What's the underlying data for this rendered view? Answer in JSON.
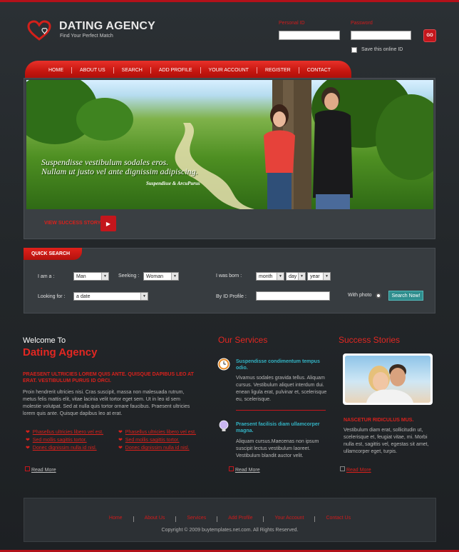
{
  "brand": {
    "title": "DATING AGENCY",
    "tagline": "Find Your Perfect Match"
  },
  "login": {
    "personal_id_label": "Personal ID",
    "password_label": "Password",
    "go_label": "GO",
    "save_label": "Save this online ID"
  },
  "nav": {
    "items": [
      "HOME",
      "ABOUT US",
      "SEARCH",
      "ADD PROFILE",
      "YOUR ACCOUNT",
      "REGISTER",
      "CONTACT"
    ]
  },
  "banner": {
    "caption_line1": "Suspendisse vestibulum sodales eros.",
    "caption_line2": "Nullam ut justo vel ante dignissim adipiscing.",
    "author": "Suspendisse  & ArcuPurus",
    "view_story": "VIEW SUCCESS STORY"
  },
  "quick_search": {
    "title": "QUICK SEARCH",
    "i_am_label": "I am a :",
    "i_am_value": "Man",
    "seeking_label": "Seeking :",
    "seeking_value": "Woman",
    "born_label": "I was born :",
    "month": "month",
    "day": "day",
    "year": "year",
    "looking_label": "Looking for :",
    "looking_value": "a date",
    "by_id_label": "By ID Profile :",
    "with_photo_label": "With photo",
    "search_button": "Search Now!"
  },
  "welcome": {
    "line1": "Welcome To",
    "line2": "Dating Agency",
    "red_caps": "PRAESENT ULTRICIES LOREM QUIS ANTE. QUISQUE DAPIBUS LEO AT ERAT. VESTIBULUM PURUS ID ORCI.",
    "body": "Proin hendrerit ultricies nisi. Cras suscipit, massa non malesuada rutrum, metus felis mattis elit, vitae lacinia velit tortor eget sem. Ut in leo id sem molestie volutpat. Sed at nulla quis tortor ornare faucibus. Praesent ultricies lorem quis ante. Quisque dapibus leo at erat.",
    "links_col1": [
      "Phasellus ultricies libero vel est.",
      "Sed mollis sagittis tortor.",
      "Donec dignissim nulla id nisl."
    ],
    "links_col2": [
      "Phasellus ultricies libero vel est.",
      "Sed mollis sagittis tortor.",
      "Donec dignissim nulla id nisl."
    ],
    "read_more": "Read More"
  },
  "services": {
    "title": "Our Services",
    "item1_title": "Suspendisse condimentum tempus odio.",
    "item1_body": "Vivamus sodales gravida tellus. Aliquam cursus. Vestibulum aliquet interdum dui. enean ligula erat, pulvinar et, scelerisque eu, scelerisque.",
    "item2_title": "Praesent facilisis diam ullamcorper magna.",
    "item2_body": "Aliquam cursus.Maecenas non ipsum suscipit lectus vestibulum laoreet. Vestibulum blandit auctor velit.",
    "read_more": "Read More"
  },
  "stories": {
    "title": "Success Stories",
    "heading": "NASCETUR RIDICULUS MUS.",
    "body": "Vestibulum diam erat, sollicitudin ut, scelerisque et, feugiat vitae, mi. Morbi nulla est, sagittis vel, egestas sit amet, ullamcorper eget, turpis.",
    "read_more": "Read More"
  },
  "footer": {
    "links": [
      "Home",
      "About Us",
      "Services",
      "Add Profile",
      "Your Account",
      "Contact Us"
    ],
    "copyright": "Copyright © 2009 buytemplates.net.com. All Rights Reserved."
  },
  "colors": {
    "accent_red": "#c4161c",
    "teal": "#33b3c4",
    "background": "#23272a"
  }
}
